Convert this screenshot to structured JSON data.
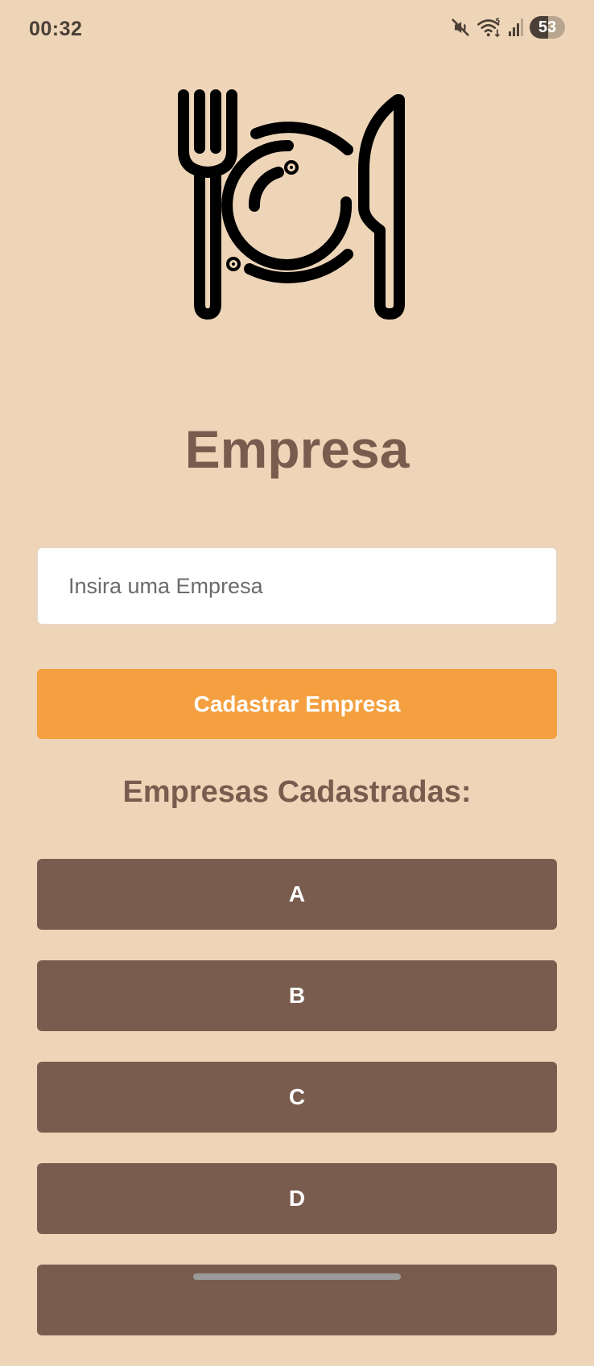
{
  "status_bar": {
    "time": "00:32",
    "battery": "53",
    "battery_level_percent": 53,
    "icons": [
      "mute-icon",
      "wifi-icon",
      "signal-icon",
      "battery-icon"
    ]
  },
  "header": {
    "logo_icon": "fork-plate-knife-icon",
    "title": "Empresa"
  },
  "form": {
    "input_value": "",
    "input_placeholder": "Insira uma Empresa",
    "submit_label": "Cadastrar Empresa"
  },
  "list": {
    "heading": "Empresas Cadastradas:",
    "items": [
      {
        "label": "A"
      },
      {
        "label": "B"
      },
      {
        "label": "C"
      },
      {
        "label": "D"
      },
      {
        "label": ""
      }
    ]
  },
  "colors": {
    "background": "#EED5B8",
    "brown": "#7A5C4E",
    "orange": "#F4A040",
    "white": "#FFFFFF"
  }
}
